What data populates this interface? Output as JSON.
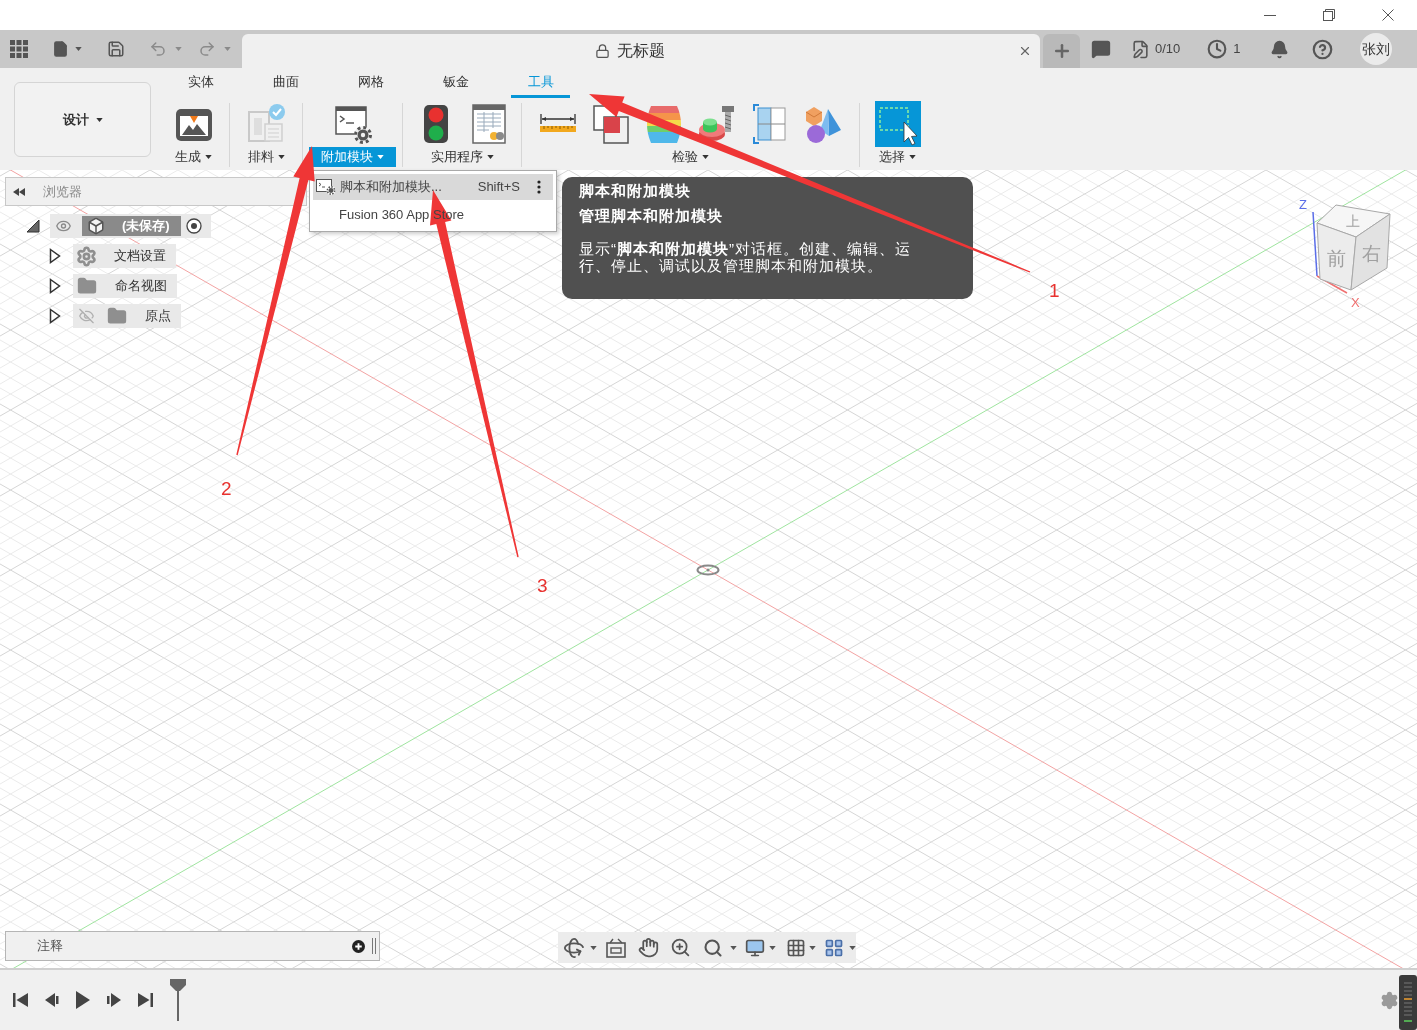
{
  "header": {
    "document_title": "无标题",
    "job_status": "0/10",
    "recent_count": "1",
    "user": "张刘"
  },
  "ribbon": {
    "workspace": "设计",
    "tabs": [
      {
        "label": "实体",
        "selected": false
      },
      {
        "label": "曲面",
        "selected": false
      },
      {
        "label": "网格",
        "selected": false
      },
      {
        "label": "钣金",
        "selected": false
      },
      {
        "label": "工具",
        "selected": true
      }
    ],
    "groups": [
      {
        "label": "生成",
        "open": false
      },
      {
        "label": "排料",
        "open": false
      },
      {
        "label": "附加模块",
        "open": true
      },
      {
        "label": "实用程序",
        "open": false
      },
      {
        "label": "检验",
        "open": false
      },
      {
        "label": "选择",
        "open": false
      }
    ]
  },
  "addins_menu": {
    "items": [
      {
        "label": "脚本和附加模块...",
        "shortcut": "Shift+S",
        "kind": "script",
        "selected": true
      },
      {
        "label": "Fusion 360 App Store",
        "kind": "plain",
        "selected": false
      }
    ]
  },
  "tooltip": {
    "title": "脚本和附加模块",
    "subtitle": "管理脚本和附加模块",
    "body": "显示“**脚本和附加模块**”对话框。创建、编辑、运行、停止、调试以及管理脚本和附加模块。"
  },
  "browser": {
    "title": "浏览器",
    "root": {
      "label": "(未保存)",
      "expanded": true,
      "visible": true,
      "children": [
        {
          "label": "文档设置",
          "kind": "settings",
          "expanded": false
        },
        {
          "label": "命名视图",
          "kind": "folder",
          "expanded": false
        },
        {
          "label": "原点",
          "kind": "folder",
          "expanded": false,
          "visible": false
        }
      ]
    }
  },
  "view_cube": {
    "top": "上",
    "front": "前",
    "right": "右",
    "axis_z": "Z",
    "axis_x": "X"
  },
  "comments": {
    "title": "注释"
  },
  "annotations": [
    {
      "label": "1"
    },
    {
      "label": "2"
    },
    {
      "label": "3"
    }
  ]
}
